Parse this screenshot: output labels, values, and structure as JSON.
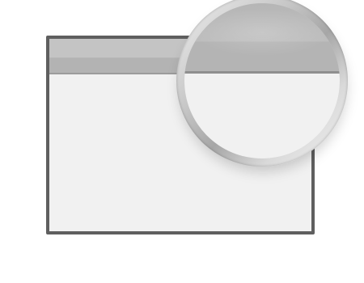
{
  "illustration": {
    "subject": "browser-window-with-magnifier",
    "colors": {
      "frame": "#5f5f5f",
      "titlebar": "#c4c4c4",
      "content": "#f1f1f1",
      "lens_ring": "#bdbdbd"
    }
  }
}
